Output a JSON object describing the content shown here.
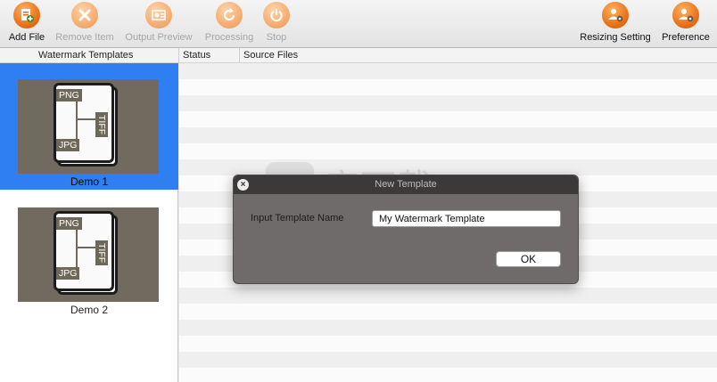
{
  "toolbar": {
    "add_file": "Add File",
    "remove_item": "Remove Item",
    "output_preview": "Output Preview",
    "processing": "Processing",
    "stop": "Stop",
    "resizing_setting": "Resizing Setting",
    "preference": "Preference",
    "icons": [
      "add-file-icon",
      "remove-item-icon",
      "output-preview-icon",
      "processing-icon",
      "stop-icon",
      "resizing-setting-icon",
      "preference-icon"
    ]
  },
  "columns": {
    "templates": "Watermark Templates",
    "status": "Status",
    "source_files": "Source Files"
  },
  "templates": [
    {
      "name": "Demo 1",
      "selected": true,
      "formats": [
        "PNG",
        "TIFF",
        "JPG"
      ]
    },
    {
      "name": "Demo 2",
      "selected": false,
      "formats": [
        "PNG",
        "TIFF",
        "JPG"
      ]
    }
  ],
  "dialog": {
    "title": "New Template",
    "input_label": "Input Template Name",
    "input_value": "My Watermark Template",
    "ok_label": "OK"
  },
  "watermark": {
    "text": "安下载",
    "subtext": "anxz.com"
  },
  "colors": {
    "accent": "#2f7ef2",
    "toolbar_icon": "#e56a10",
    "dialog_bg": "#6f6b6b"
  }
}
